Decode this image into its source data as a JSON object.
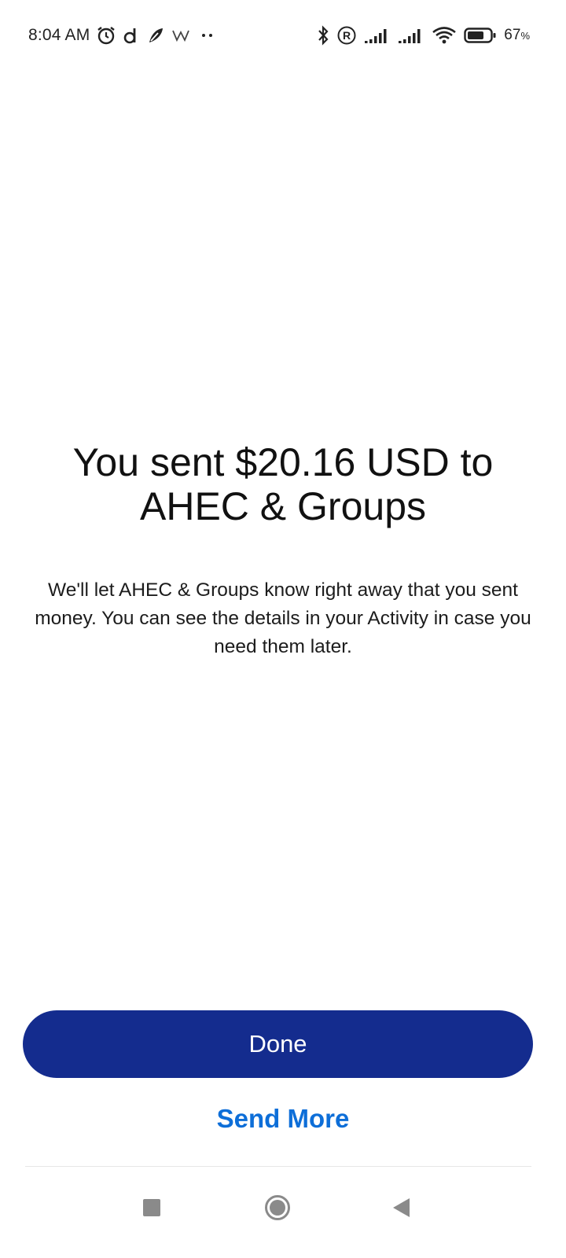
{
  "status_bar": {
    "time": "8:04 AM",
    "battery_percent": "67",
    "battery_unit": "%",
    "notification_icons": [
      "alarm-icon",
      "d-app-icon",
      "feather-app-icon",
      "w-app-icon",
      "more-dots-icon"
    ],
    "system_icons": [
      "bluetooth-icon",
      "registered-icon",
      "signal-1-icon",
      "signal-2-icon",
      "wifi-icon",
      "battery-icon"
    ]
  },
  "confirmation": {
    "headline": "You sent $20.16 USD to AHEC & Groups",
    "message": "We'll let AHEC & Groups know right away that you sent money. You can see the details in your Activity in case you need them later."
  },
  "actions": {
    "done_label": "Done",
    "send_more_label": "Send More"
  },
  "colors": {
    "primary_button": "#142c8e",
    "link": "#0d6ed8",
    "text": "#111111"
  },
  "nav_bar": {
    "buttons": [
      "recents-square-icon",
      "home-circle-icon",
      "back-triangle-icon"
    ]
  }
}
